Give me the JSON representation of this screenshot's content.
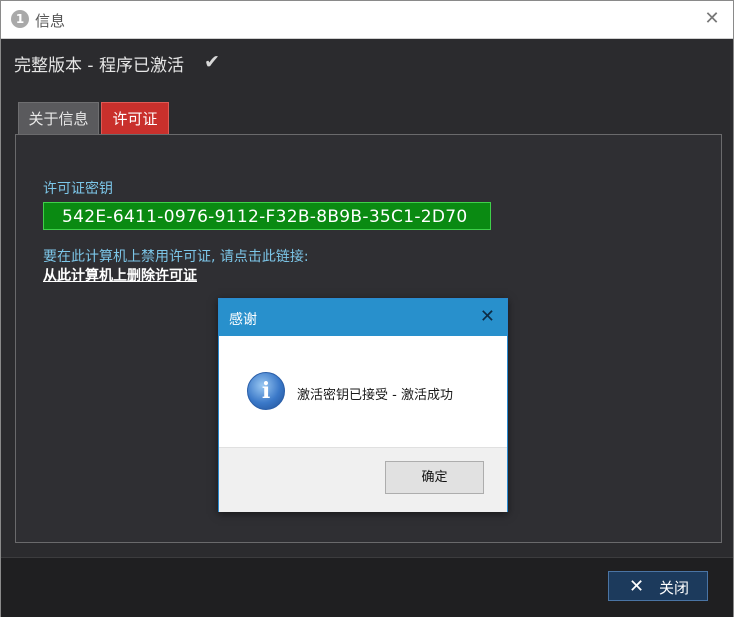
{
  "window": {
    "title_icon_glyph": "1",
    "title": "信息",
    "close_glyph": "✕"
  },
  "status": {
    "text": "完整版本 - 程序已激活",
    "check_glyph": "✔"
  },
  "tabs": [
    {
      "label": "关于信息",
      "active": false
    },
    {
      "label": "许可证",
      "active": true
    }
  ],
  "license": {
    "key_label": "许可证密钥",
    "key_value": "542E-6411-0976-9112-F32B-8B9B-35C1-2D70",
    "disable_text": "要在此计算机上禁用许可证, 请点击此链接:",
    "remove_link": "从此计算机上删除许可证"
  },
  "footer": {
    "close_glyph": "✕",
    "close_label": "关闭"
  },
  "dialog": {
    "title": "感谢",
    "close_glyph": "✕",
    "icon_glyph": "i",
    "message": "激活密钥已接受 - 激活成功",
    "ok_label": "确定"
  },
  "colors": {
    "tab_active": "#c9302c",
    "key_box": "#0a8a12",
    "dialog_titlebar": "#2890cc",
    "label_text": "#7cc6e8"
  }
}
